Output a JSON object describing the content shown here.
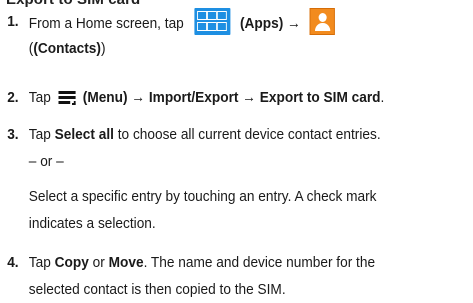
{
  "cut_heading": "Export to SIM card",
  "steps": [
    {
      "number": "1.",
      "lines": {
        "l1_pre": "From a Home screen, tap",
        "apps_label": "(Apps)",
        "arrow": "→",
        "l2_contacts": "(Contacts)",
        "l2_end": "."
      }
    },
    {
      "number": "2.",
      "lines": {
        "tap": "Tap",
        "menu_label": "(Menu)",
        "arrow1": "→",
        "import_export": "Import/Export",
        "arrow2": "→",
        "export_sim": "Export to SIM card",
        "end": "."
      }
    },
    {
      "number": "3.",
      "lines": {
        "tap": "Tap",
        "select_all": "Select all",
        "rest": "to choose all current device contact entries.",
        "or": "– or –",
        "l3": "Select a specific entry by touching an entry. A check mark",
        "l4": "indicates a selection."
      }
    },
    {
      "number": "4.",
      "lines": {
        "tap": "Tap",
        "copy": "Copy",
        "or": "or",
        "move": "Move",
        "rest": ". The name and device number for the",
        "l2": "selected contact is then copied to the SIM."
      }
    }
  ],
  "icons": {
    "apps": "apps-grid-icon",
    "contacts": "contacts-icon",
    "menu": "menu-icon"
  },
  "colors": {
    "apps_icon": "#1e8fe2",
    "contacts_icon": "#f28b1e"
  }
}
